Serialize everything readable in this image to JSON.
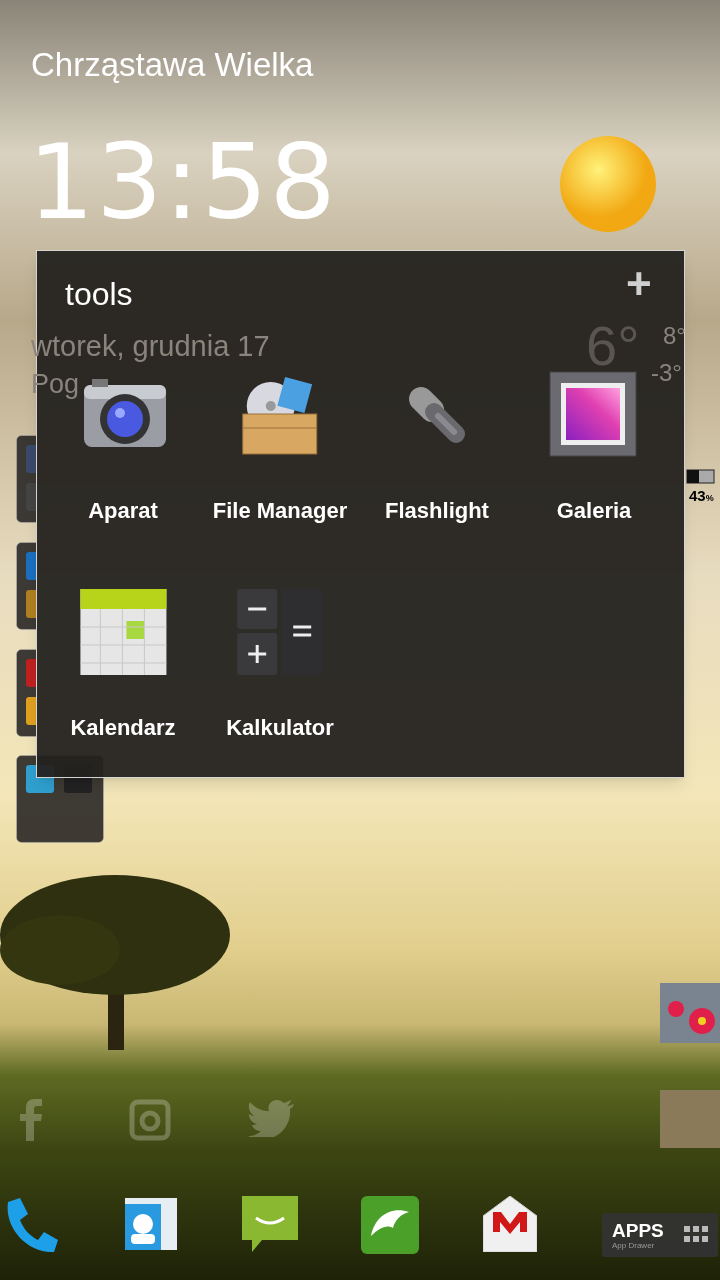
{
  "weather_widget": {
    "location": "Chrząstawa Wielka",
    "time": "13:58",
    "date": "wtorek, grudnia 17",
    "condition": "Pog",
    "temperature": "6°",
    "high": "8°",
    "low": "-3°"
  },
  "folder": {
    "title": "tools",
    "add_label": "+",
    "apps": [
      {
        "label": "Aparat",
        "kind": "camera"
      },
      {
        "label": "File Manager",
        "kind": "files"
      },
      {
        "label": "Flashlight",
        "kind": "flashlight"
      },
      {
        "label": "Galeria",
        "kind": "gallery"
      },
      {
        "label": "Kalendarz",
        "kind": "calendar"
      },
      {
        "label": "Kalkulator",
        "kind": "calculator"
      }
    ]
  },
  "side_folders": [
    {
      "kind": "tools"
    },
    {
      "kind": "transport"
    },
    {
      "kind": "media"
    },
    {
      "kind": "games"
    }
  ],
  "battery_widget": {
    "percent": "43",
    "unit": "%"
  },
  "social_shortcuts": [
    {
      "kind": "facebook"
    },
    {
      "kind": "instagram"
    },
    {
      "kind": "twitter"
    }
  ],
  "contact_shortcuts": [
    {
      "kind": "flower"
    },
    {
      "kind": "photo"
    }
  ],
  "dock": {
    "apps": [
      {
        "kind": "phone"
      },
      {
        "kind": "contacts"
      },
      {
        "kind": "messaging"
      },
      {
        "kind": "browser"
      },
      {
        "kind": "mail"
      }
    ],
    "app_drawer": {
      "label": "APPS",
      "sublabel": "App Drawer"
    }
  }
}
